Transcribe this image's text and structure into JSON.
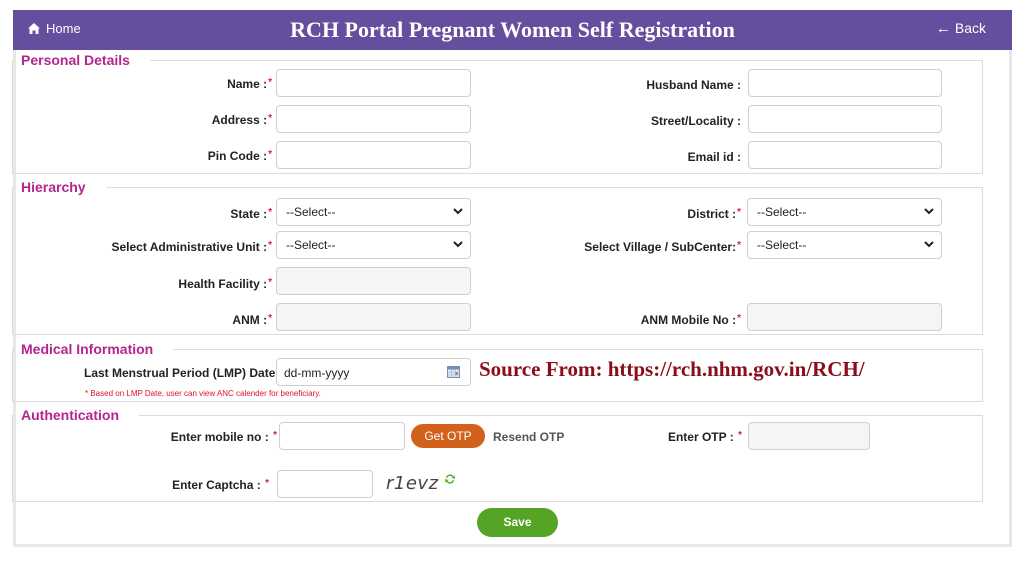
{
  "header": {
    "home_label": "Home",
    "title": "RCH Portal Pregnant Women Self Registration",
    "back_label": "Back",
    "back_arrow": "←"
  },
  "sections": {
    "personal": {
      "legend": "Personal Details",
      "fields": {
        "name": {
          "label": "Name :",
          "required": "*",
          "value": ""
        },
        "address": {
          "label": "Address :",
          "required": "*",
          "value": ""
        },
        "pin_code": {
          "label": "Pin Code :",
          "required": "*",
          "value": ""
        },
        "husband_name": {
          "label": "Husband Name :",
          "value": ""
        },
        "street": {
          "label": "Street/Locality :",
          "value": ""
        },
        "email": {
          "label": "Email id :",
          "value": ""
        }
      }
    },
    "hierarchy": {
      "legend": "Hierarchy",
      "fields": {
        "state": {
          "label": "State :",
          "required": "*",
          "selected": "--Select--"
        },
        "admin_unit": {
          "label": "Select Administrative Unit :",
          "required": "*",
          "selected": "--Select--"
        },
        "health_facility": {
          "label": "Health Facility :",
          "required": "*",
          "value": ""
        },
        "anm": {
          "label": "ANM :",
          "required": "*",
          "value": ""
        },
        "district": {
          "label": "District :",
          "required": "*",
          "selected": "--Select--"
        },
        "village": {
          "label": "Select Village / SubCenter:",
          "required": "*",
          "selected": "--Select--"
        },
        "anm_mobile": {
          "label": "ANM Mobile No :",
          "required": "*",
          "value": ""
        }
      }
    },
    "medical": {
      "legend": "Medical Information",
      "lmp_label": "Last Menstrual Period (LMP) Date :",
      "lmp_placeholder": "dd-mm-yyyy",
      "note": "* Based on LMP Date, user can view ANC calender for beneficiary."
    },
    "auth": {
      "legend": "Authentication",
      "mobile_label": "Enter mobile no :",
      "required": "*",
      "get_otp_label": "Get OTP",
      "resend_otp_label": "Resend OTP",
      "otp_label": "Enter OTP :",
      "captcha_label": "Enter Captcha :",
      "captcha_text": "r1evz"
    }
  },
  "watermark": "Source From: https://rch.nhm.gov.in/RCH/",
  "save_label": "Save",
  "colors": {
    "header": "#664e9e",
    "legend": "#b5248f",
    "get_otp": "#d2611b",
    "save": "#55a426",
    "required": "#e0115f",
    "watermark": "#8b0d1a"
  }
}
